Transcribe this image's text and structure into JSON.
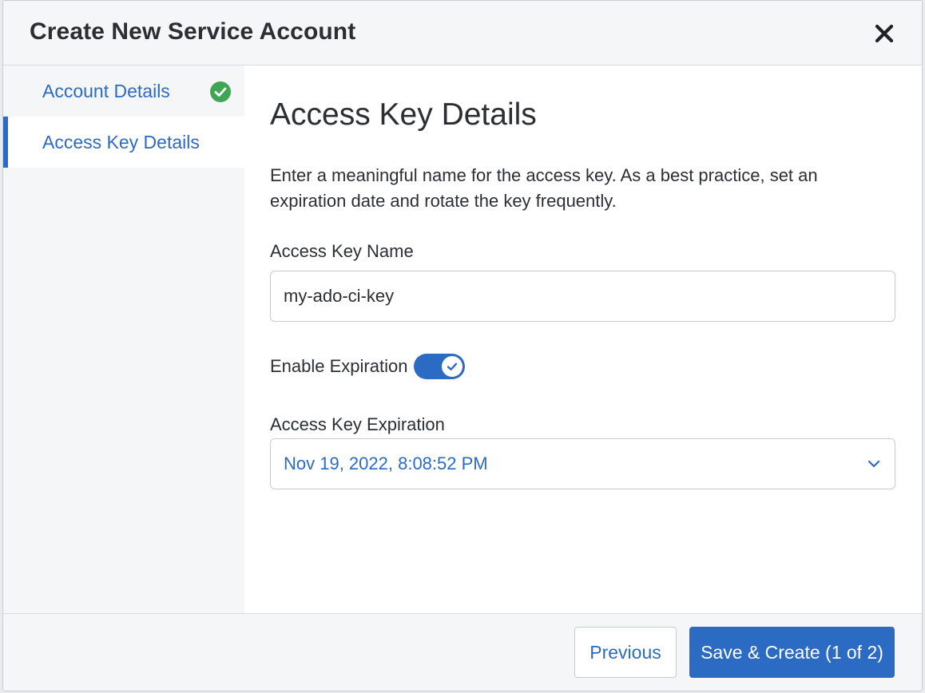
{
  "dialog": {
    "title": "Create New Service Account",
    "close_icon": "close-icon"
  },
  "steps": [
    {
      "label": "Account Details",
      "completed": true,
      "active": false,
      "icon": "check-circle-icon"
    },
    {
      "label": "Access Key Details",
      "completed": false,
      "active": true
    }
  ],
  "content": {
    "title": "Access Key Details",
    "description": "Enter a meaningful name for the access key. As a best practice, set an expiration date and rotate the key frequently.",
    "name_field": {
      "label": "Access Key Name",
      "value": "my-ado-ci-key"
    },
    "expiration_toggle": {
      "label": "Enable Expiration",
      "enabled": true
    },
    "expiration_field": {
      "label": "Access Key Expiration",
      "value": "Nov 19, 2022, 8:08:52 PM",
      "icon": "chevron-down-icon"
    }
  },
  "footer": {
    "previous_label": "Previous",
    "submit_label": "Save & Create (1 of 2)"
  },
  "colors": {
    "accent": "#2c6bc4",
    "success": "#3ea555",
    "panel": "#f5f6f7",
    "text": "#2b2f33"
  }
}
